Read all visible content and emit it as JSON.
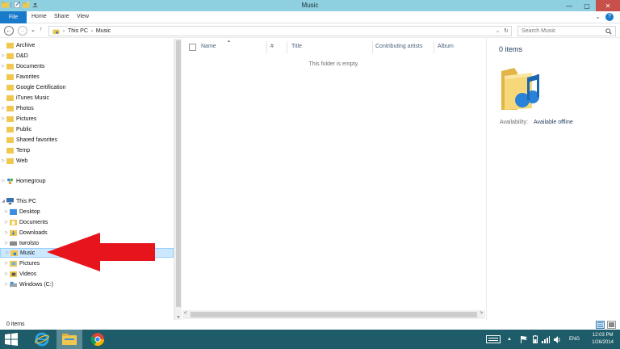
{
  "window": {
    "title": "Music",
    "controls": {
      "minimize": "—",
      "maximize": "▢",
      "close": "✕"
    }
  },
  "ribbon": {
    "file": "File",
    "tabs": [
      "Home",
      "Share",
      "View"
    ],
    "help": "?"
  },
  "address": {
    "crumbs": [
      "This PC",
      "Music"
    ],
    "search_placeholder": "Search Music"
  },
  "nav_tree": {
    "favorites": [
      "Archive",
      "D&D",
      "Documents",
      "Favorites",
      "Google Certification",
      "iTunes Music",
      "Photos",
      "Pictures",
      "Public",
      "Shared favorites",
      "Temp",
      "Web"
    ],
    "homegroup": "Homegroup",
    "this_pc": "This PC",
    "this_pc_items": [
      "Desktop",
      "Documents",
      "Downloads",
      "twrolsto",
      "Music",
      "Pictures",
      "Videos",
      "Windows (C:)"
    ],
    "selected": "Music"
  },
  "content": {
    "columns": [
      "Name",
      "#",
      "Title",
      "Contributing artists",
      "Album"
    ],
    "empty_message": "This folder is empty."
  },
  "details": {
    "count": "0 items",
    "availability_label": "Availability:",
    "availability_value": "Available offline"
  },
  "status": {
    "items": "0 items"
  },
  "taskbar": {
    "language": "ENG",
    "time": "12:03 PM",
    "date": "1/26/2014"
  },
  "colors": {
    "titlebar": "#8fd0e0",
    "accent": "#1979ca",
    "selection": "#cce8ff",
    "taskbar": "#1f5c69",
    "arrow": "#e8141c"
  }
}
